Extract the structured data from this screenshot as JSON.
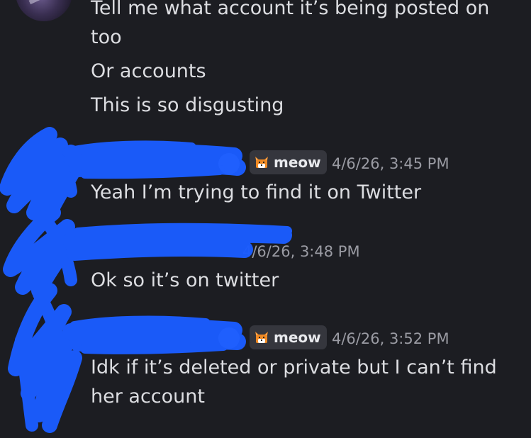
{
  "messages_top": {
    "lines": [
      "Tell me what account it’s being posted on",
      "too",
      "Or accounts",
      "This is so disgusting"
    ]
  },
  "message_1": {
    "tag_label": "meow",
    "timestamp": "4/6/26, 3:45 PM",
    "text": "Yeah I’m trying to find it on Twitter"
  },
  "message_2": {
    "timestamp": "4/6/26, 3:48 PM",
    "text": "Ok so it’s on twitter"
  },
  "message_3": {
    "tag_label": "meow",
    "timestamp": "4/6/26, 3:52 PM",
    "text_lines": [
      "Idk if it’s deleted or private but I can’t find",
      "her account"
    ]
  },
  "colors": {
    "background": "#1c1d22",
    "message_text": "#dcdde1",
    "timestamp": "#9a9ba3",
    "tag_background": "#35363d",
    "redaction_scribble": "#1a5cff"
  },
  "icons": {
    "tag_icon": "fox-face-icon"
  }
}
